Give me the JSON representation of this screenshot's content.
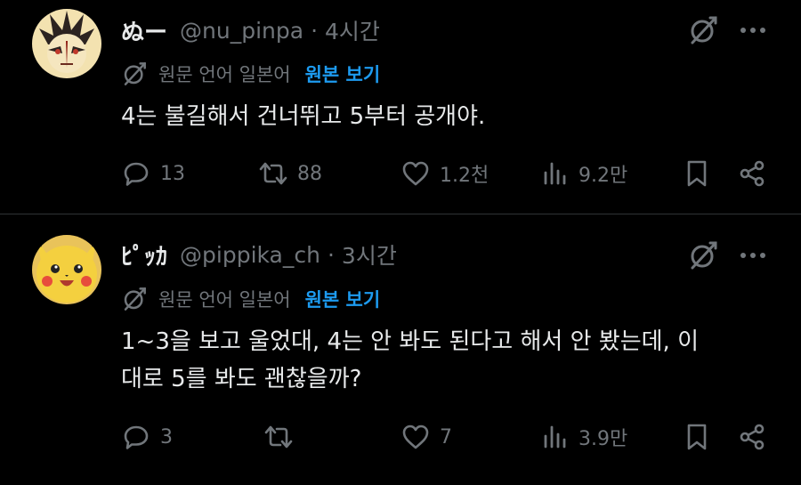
{
  "tweets": [
    {
      "display_name": "ぬー",
      "handle": "@nu_pinpa",
      "separator": "·",
      "time": "4시간",
      "translate_label": "원문 언어 일본어",
      "translate_link": "원본 보기",
      "text": "4는 불길해서 건너뛰고 5부터 공개야.",
      "replies": "13",
      "retweets": "88",
      "likes": "1.2천",
      "views": "9.2만"
    },
    {
      "display_name": "ﾋﾟｯｶ",
      "handle": "@pippika_ch",
      "separator": "·",
      "time": "3시간",
      "translate_label": "원문 언어 일본어",
      "translate_link": "원본 보기",
      "text_line1": "1~3을 보고 울었대, 4는 안 봐도 된다고 해서 안 봤는데, 이",
      "text_line2": "대로 5를 봐도 괜찮을까?",
      "replies": "3",
      "retweets": "",
      "likes": "7",
      "views": "3.9만"
    }
  ],
  "icons": {
    "reply": "reply-icon",
    "retweet": "retweet-icon",
    "like": "heart-icon",
    "views": "views-icon",
    "bookmark": "bookmark-icon",
    "share": "share-icon",
    "grok": "grok-icon",
    "more": "more-icon",
    "translate": "translate-icon"
  },
  "colors": {
    "background": "#000000",
    "text": "#e7e9ea",
    "secondary": "#71767b",
    "link": "#1d9bf0",
    "divider": "#2f3336"
  }
}
